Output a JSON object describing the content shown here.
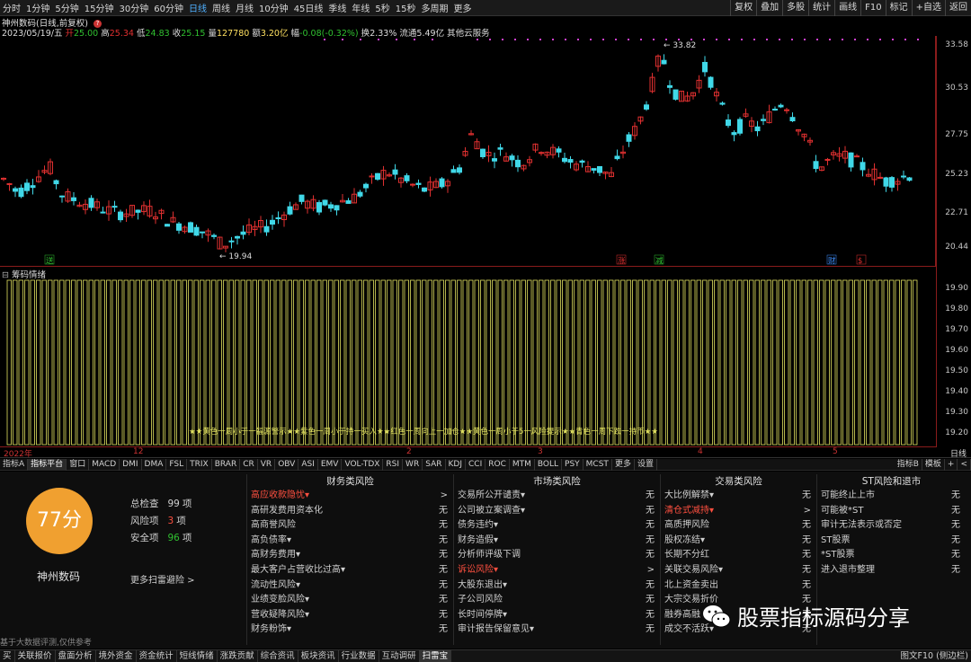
{
  "periods": [
    "分时",
    "1分钟",
    "5分钟",
    "15分钟",
    "30分钟",
    "60分钟",
    "日线",
    "周线",
    "月线",
    "10分钟",
    "45日线",
    "季线",
    "年线",
    "5秒",
    "15秒",
    "多周期",
    "更多"
  ],
  "period_active": "日线",
  "toolbar_right": [
    "复权",
    "叠加",
    "多股",
    "统计",
    "画线",
    "F10",
    "标记",
    "+自选",
    "返回"
  ],
  "stock_title": "神州数码(日线,前复权)",
  "info": {
    "date": "2023/05/19/五",
    "open_label": "开",
    "open": "25.00",
    "high_label": "高",
    "high": "25.34",
    "low_label": "低",
    "low": "24.83",
    "close_label": "收",
    "close": "25.15",
    "vol_label": "量",
    "vol": "127780",
    "amount_label": "额",
    "amount": "3.20亿",
    "change_label": "幅",
    "change": "-0.08(-0.32%)",
    "turnover_label": "换",
    "turnover": "2.33%",
    "float_label": "流通",
    "float": "5.49亿",
    "service": "其他云服务"
  },
  "price_axis": [
    "33.58",
    "30.53",
    "27.75",
    "25.23",
    "22.71",
    "20.44"
  ],
  "indicator_axis": [
    "19.90",
    "19.80",
    "19.70",
    "19.60",
    "19.50",
    "19.40",
    "19.30",
    "19.20"
  ],
  "annotations": {
    "high": "33.82",
    "low": "19.94"
  },
  "event_markers": [
    {
      "label": "送",
      "color": "#30c030"
    },
    {
      "label": "涨",
      "color": "#e03030"
    },
    {
      "label": "减",
      "color": "#30c030"
    },
    {
      "label": "财",
      "color": "#4090ff"
    },
    {
      "label": "$",
      "color": "#e03030"
    }
  ],
  "indicator_title": "筹码情绪",
  "indicator_legend": "★★黄色一周小于一福源警示★★紫色一周小于持一买入★★红色一周向上一加仓★★黄色一周小于5一风险提示★★青色一周下跌一持币★★",
  "time_labels": [
    "2022年",
    "12",
    "2",
    "3",
    "4",
    "5"
  ],
  "time_right": "日线",
  "indicator_tabs": [
    "指标A",
    "指标平台",
    "窗口",
    "MACD",
    "DMI",
    "DMA",
    "FSL",
    "TRIX",
    "BRAR",
    "CR",
    "VR",
    "OBV",
    "ASI",
    "EMV",
    "VOL-TDX",
    "RSI",
    "WR",
    "SAR",
    "KDJ",
    "CCI",
    "ROC",
    "MTM",
    "BOLL",
    "PSY",
    "MCST",
    "更多",
    "设置"
  ],
  "indicator_tabs_right": [
    "指标B",
    "模板",
    "+",
    "<"
  ],
  "score": "77分",
  "company": "神州数码",
  "stats": [
    {
      "label": "总检查",
      "value": "99",
      "unit": "项",
      "color": "#d0d0d0"
    },
    {
      "label": "风险项",
      "value": "3",
      "unit": "项",
      "color": "#ff5040"
    },
    {
      "label": "安全项",
      "value": "96",
      "unit": "项",
      "color": "#30c030"
    }
  ],
  "more_scan": "更多扫雷避险 >",
  "disclaimer": "基于大数据评测,仅供参考",
  "risk_columns": [
    {
      "title": "财务类风险",
      "rows": [
        {
          "name": "高应收款隐忧▾",
          "status": ">",
          "red": true
        },
        {
          "name": "高研发费用资本化",
          "status": "无"
        },
        {
          "name": "高商誉风险",
          "status": "无"
        },
        {
          "name": "高负债率▾",
          "status": "无"
        },
        {
          "name": "高财务费用▾",
          "status": "无"
        },
        {
          "name": "最大客户占营收比过高▾",
          "status": "无"
        },
        {
          "name": "流动性风险▾",
          "status": "无"
        },
        {
          "name": "业绩变脸风险▾",
          "status": "无"
        },
        {
          "name": "营收疑降风险▾",
          "status": "无"
        },
        {
          "name": "财务粉饰▾",
          "status": "无"
        }
      ]
    },
    {
      "title": "市场类风险",
      "rows": [
        {
          "name": "交易所公开谴责▾",
          "status": "无"
        },
        {
          "name": "公司被立案调查▾",
          "status": "无"
        },
        {
          "name": "债务违约▾",
          "status": "无"
        },
        {
          "name": "财务造假▾",
          "status": "无"
        },
        {
          "name": "分析师评级下调",
          "status": "无"
        },
        {
          "name": "诉讼风险▾",
          "status": ">",
          "red": true
        },
        {
          "name": "大股东退出▾",
          "status": "无"
        },
        {
          "name": "子公司风险",
          "status": "无"
        },
        {
          "name": "长时间停牌▾",
          "status": "无"
        },
        {
          "name": "审计报告保留意见▾",
          "status": "无"
        }
      ]
    },
    {
      "title": "交易类风险",
      "rows": [
        {
          "name": "大比例解禁▾",
          "status": "无"
        },
        {
          "name": "清仓式减持▾",
          "status": ">",
          "red": true
        },
        {
          "name": "高质押风险",
          "status": "无"
        },
        {
          "name": "股权冻结▾",
          "status": "无"
        },
        {
          "name": "长期不分红",
          "status": "无"
        },
        {
          "name": "关联交易风险▾",
          "status": "无"
        },
        {
          "name": "北上资金卖出",
          "status": "无"
        },
        {
          "name": "大宗交易折价",
          "status": "无"
        },
        {
          "name": "融券高融",
          "status": "无"
        },
        {
          "name": "成交不活跃▾",
          "status": "无"
        }
      ]
    },
    {
      "title": "ST风险和退市",
      "rows": [
        {
          "name": "可能终止上市",
          "status": "无"
        },
        {
          "name": "可能被*ST",
          "status": "无"
        },
        {
          "name": "审计无法表示或否定",
          "status": "无"
        },
        {
          "name": "ST股票",
          "status": "无"
        },
        {
          "name": "*ST股票",
          "status": "无"
        },
        {
          "name": "进入退市整理",
          "status": "无"
        }
      ]
    }
  ],
  "bottom_tabs": [
    "买",
    "关联报价",
    "盘面分析",
    "境外资金",
    "资金统计",
    "短线情绪",
    "涨跌贡献",
    "综合资讯",
    "板块资讯",
    "行业数据",
    "互动调研",
    "扫雷宝"
  ],
  "bottom_active": "扫雷宝",
  "bottom_right": "图文F10 (侧边栏)",
  "watermark": "股票指标源码分享",
  "colors": {
    "up": "#e03030",
    "down": "#40d8e8",
    "frame": "#8a1c1c",
    "yellow": "#e0e060",
    "score_bg": "#f0a030"
  }
}
